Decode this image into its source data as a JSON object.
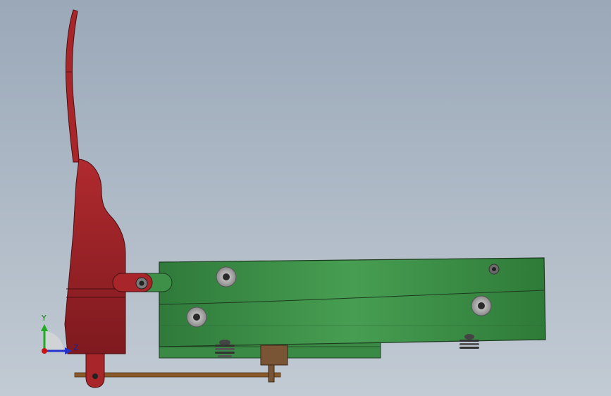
{
  "viewport": {
    "background_top": "#9AA8B8",
    "background_bottom": "#C2CBD4"
  },
  "triad": {
    "y_label": "Y",
    "z_label": "Z",
    "y_color": "#22AA22",
    "z_color": "#2233CC",
    "origin_color": "#CC1111"
  },
  "parts": {
    "lever": {
      "name": "lever-arm",
      "color": "#A8262A"
    },
    "body": {
      "name": "green-housing",
      "color": "#3E8F47"
    },
    "rod": {
      "name": "rod",
      "color": "#8B5A2B"
    },
    "block": {
      "name": "connector-block",
      "color": "#7A5535"
    },
    "fasteners": {
      "name": "bolts",
      "color": "#9A9A9A"
    }
  }
}
